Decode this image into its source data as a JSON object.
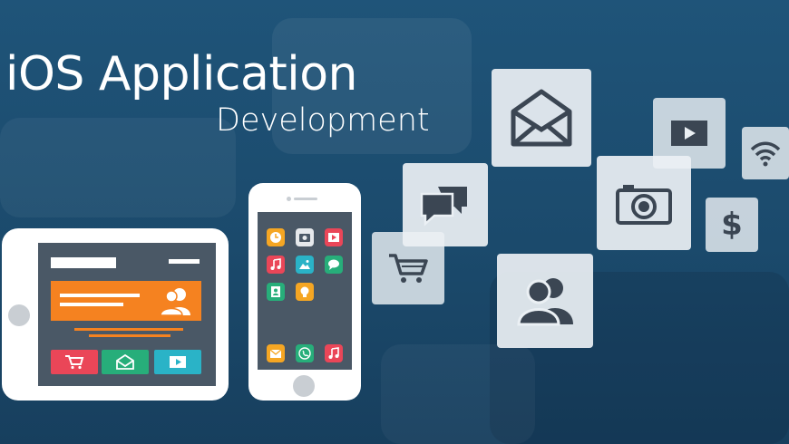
{
  "heading": {
    "title": "iOS Application",
    "subtitle": "Development"
  },
  "colors": {
    "background": "#1f5479",
    "accent_orange": "#f58220",
    "accent_red": "#ea4658",
    "accent_green": "#27ae7a",
    "accent_teal": "#2ab3c7",
    "device_screen": "#4a5866",
    "tile": "#ebf0f4",
    "icon_dark": "#3b4653"
  },
  "tablet": {
    "buttons": [
      "cart-icon",
      "mail-icon",
      "play-icon"
    ]
  },
  "phone": {
    "apps": [
      "clock-icon",
      "camera-icon",
      "video-icon",
      "music-icon",
      "photos-icon",
      "chat-icon",
      "contacts-icon",
      "idea-icon"
    ],
    "dock": [
      "mail-icon",
      "phone-icon",
      "music-icon"
    ]
  },
  "tiles": [
    "mail-icon",
    "play-icon",
    "wifi-icon",
    "chat-icon",
    "camera-icon",
    "dollar-icon",
    "cart-icon",
    "users-icon"
  ],
  "dollar_symbol": "$"
}
